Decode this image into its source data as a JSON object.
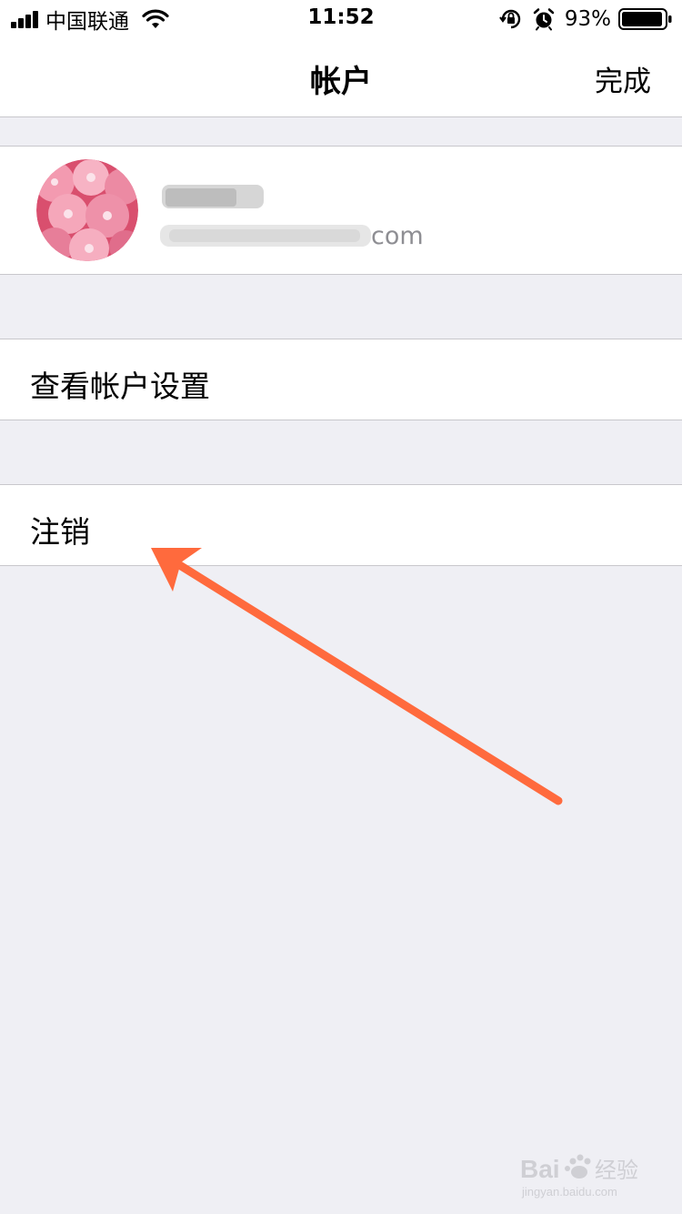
{
  "status_bar": {
    "carrier": "中国联通",
    "time": "11:52",
    "battery_percent": "93%",
    "signal_bars": 4,
    "battery_level": 0.93,
    "icons": [
      "signal-icon",
      "wifi-icon",
      "orientation-lock-icon",
      "alarm-icon",
      "battery-icon"
    ]
  },
  "nav": {
    "title": "帐户",
    "done_label": "完成"
  },
  "account": {
    "email_suffix": "com"
  },
  "menu": {
    "view_settings_label": "查看帐户设置",
    "logout_label": "注销"
  },
  "annotation": {
    "arrow_color": "#ff6a3d"
  },
  "colors": {
    "background": "#efeff4",
    "separator": "#c8c7cc",
    "cell": "#ffffff"
  },
  "watermark": {
    "text": "Baidu经验",
    "subtext": "jingyan.baidu.com"
  }
}
